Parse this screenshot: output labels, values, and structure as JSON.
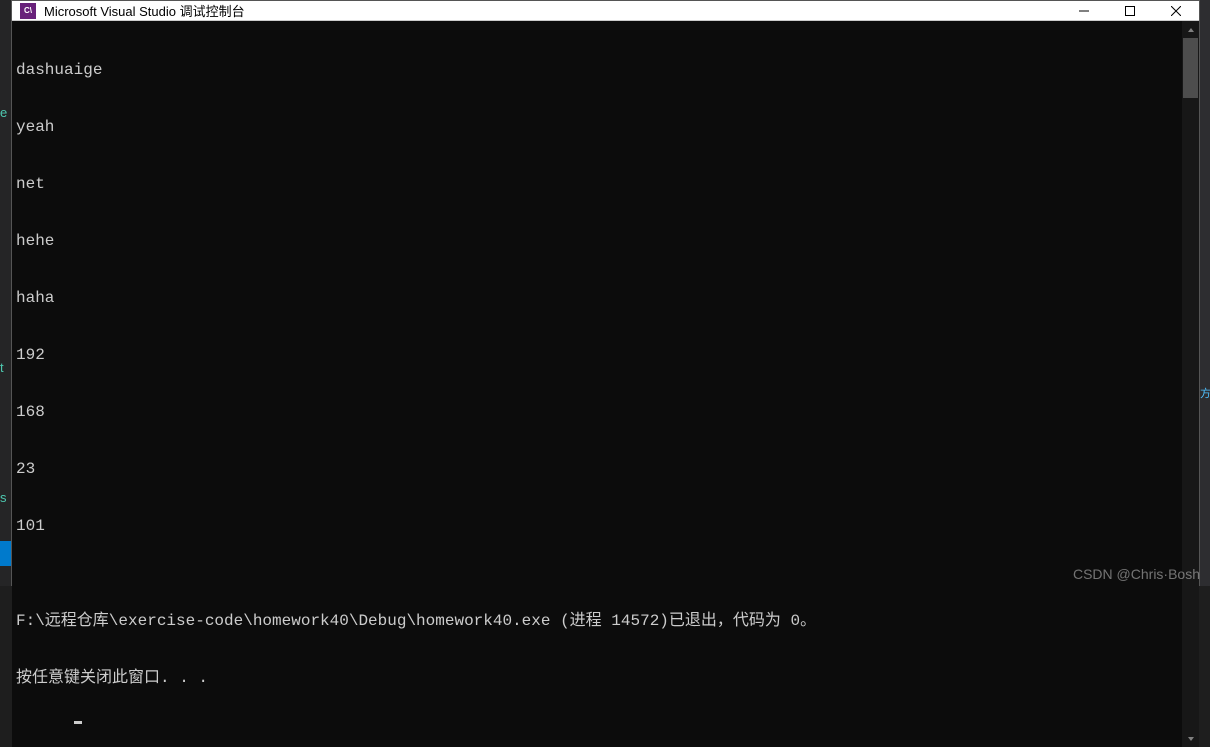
{
  "titlebar": {
    "icon_text": "C\\",
    "title": "Microsoft Visual Studio 调试控制台"
  },
  "console": {
    "lines": [
      "dashuaige",
      "yeah",
      "net",
      "hehe",
      "haha",
      "192",
      "168",
      "23",
      "101",
      "",
      "F:\\远程仓库\\exercise-code\\homework40\\Debug\\homework40.exe (进程 14572)已退出，代码为 0。",
      "按任意键关闭此窗口. . ."
    ]
  },
  "watermark": "CSDN @Chris·Bosh",
  "bg_chars": {
    "e": "e",
    "t": "t",
    "s": "s"
  },
  "right_hint": "方"
}
